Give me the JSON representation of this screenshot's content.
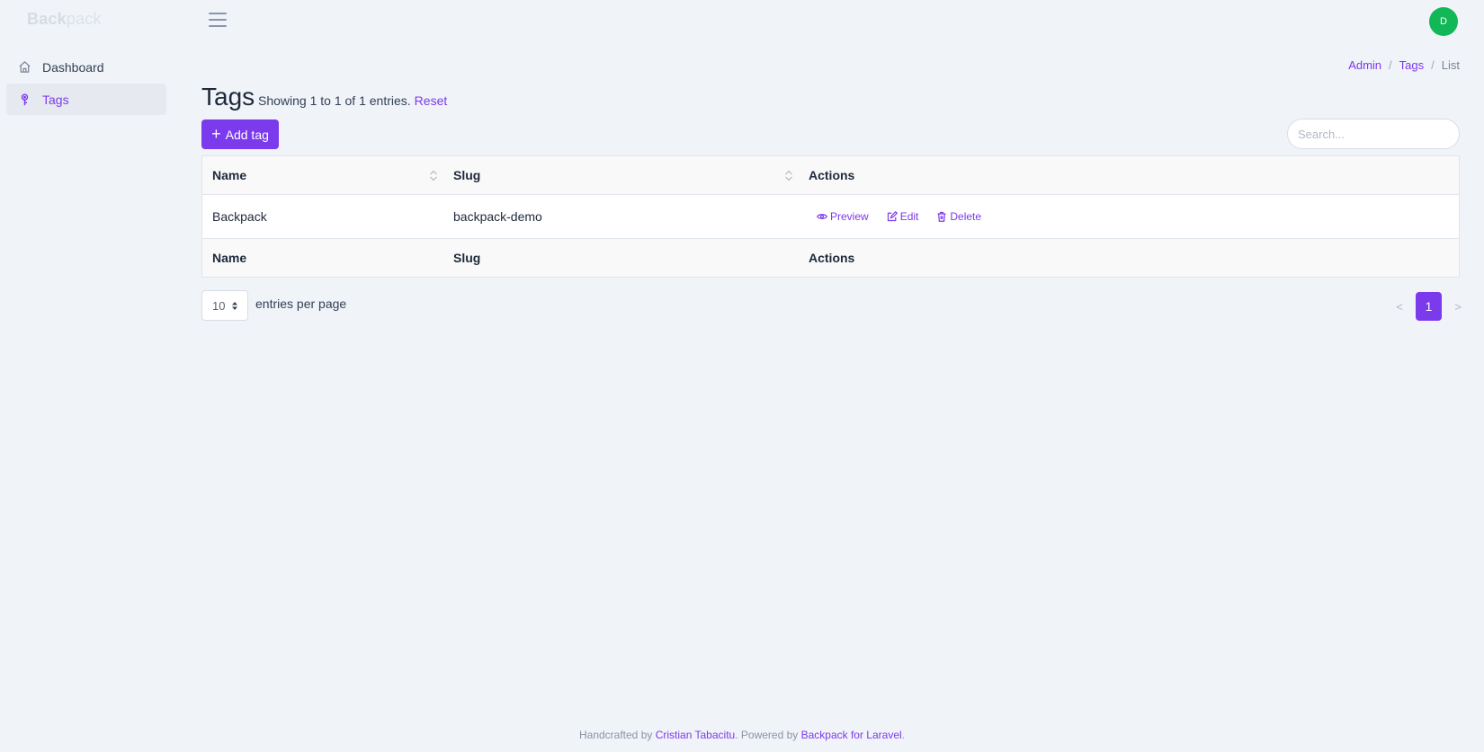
{
  "brand": {
    "part1": "Back",
    "part2": "pack"
  },
  "user": {
    "initial": "D",
    "avatar_color": "#12b857"
  },
  "sidebar": {
    "items": [
      {
        "label": "Dashboard",
        "icon": "home-icon",
        "active": false
      },
      {
        "label": "Tags",
        "icon": "tag-icon",
        "active": true
      }
    ]
  },
  "breadcrumb": {
    "items": [
      "Admin",
      "Tags",
      "List"
    ],
    "separator": "/"
  },
  "header": {
    "title": "Tags",
    "showing": "Showing 1 to 1 of 1 entries.",
    "reset": "Reset"
  },
  "toolbar": {
    "add_label": "Add tag",
    "search_placeholder": "Search..."
  },
  "table": {
    "columns": [
      "Name",
      "Slug",
      "Actions"
    ],
    "rows": [
      {
        "name": "Backpack",
        "slug": "backpack-demo"
      }
    ],
    "actions": {
      "preview": "Preview",
      "edit": "Edit",
      "delete": "Delete"
    }
  },
  "pagination": {
    "per_page": "10",
    "per_page_label": "entries per page",
    "prev": "<",
    "current": "1",
    "next": ">"
  },
  "footer": {
    "text1": "Handcrafted by",
    "author": "Cristian Tabacitu",
    "text2": ". Powered by",
    "product": "Backpack for Laravel",
    "text3": "."
  },
  "colors": {
    "accent": "#7c3aed",
    "background": "#f0f3f8"
  }
}
